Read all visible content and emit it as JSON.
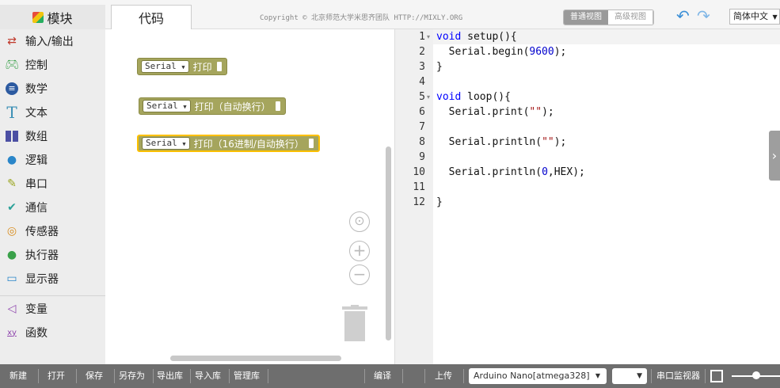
{
  "tabs": {
    "blocks": "模块",
    "code": "代码"
  },
  "copyright": "Copyright © 北京师范大学米思齐团队 HTTP://MIXLY.ORG",
  "view_switch": {
    "normal": "普通视图",
    "advanced": "高级视图"
  },
  "language": "简体中文",
  "categories": [
    {
      "icon": "arrows-icon",
      "label": "输入/输出",
      "color": "#c0392b"
    },
    {
      "icon": "gamepad-icon",
      "label": "控制",
      "color": "#3aa14a"
    },
    {
      "icon": "math-icon",
      "label": "数学",
      "color": "#2c5aa0"
    },
    {
      "icon": "text-icon",
      "label": "文本",
      "color": "#3a8fb5"
    },
    {
      "icon": "array-icon",
      "label": "数组",
      "color": "#4b4fa3"
    },
    {
      "icon": "bulb-icon",
      "label": "逻辑",
      "color": "#2a86c9"
    },
    {
      "icon": "pencil-icon",
      "label": "串口",
      "color": "#9aa51f"
    },
    {
      "icon": "comms-icon",
      "label": "通信",
      "color": "#2aa198"
    },
    {
      "icon": "sensor-icon",
      "label": "传感器",
      "color": "#d98c1c"
    },
    {
      "icon": "actuator-icon",
      "label": "执行器",
      "color": "#3aa14a"
    },
    {
      "icon": "display-icon",
      "label": "显示器",
      "color": "#2a86c9"
    },
    {
      "icon": "variable-icon",
      "label": "变量",
      "color": "#8e44ad"
    },
    {
      "icon": "function-icon",
      "label": "函数",
      "color": "#8e44ad"
    }
  ],
  "blocks": [
    {
      "dropdown": "Serial",
      "text": "打印"
    },
    {
      "dropdown": "Serial",
      "text": "打印（自动换行）"
    },
    {
      "dropdown": "Serial",
      "text": "打印（16进制/自动换行）"
    }
  ],
  "code": {
    "line_numbers": [
      "1",
      "2",
      "3",
      "4",
      "5",
      "6",
      "7",
      "8",
      "9",
      "10",
      "11",
      "12"
    ]
  },
  "bottom": {
    "new": "新建",
    "open": "打开",
    "save": "保存",
    "save_as": "另存为",
    "export_lib": "导出库",
    "import_lib": "导入库",
    "manage_lib": "管理库",
    "compile": "编译",
    "upload": "上传",
    "board": "Arduino Nano[atmega328]",
    "serial_monitor": "串口监视器"
  }
}
